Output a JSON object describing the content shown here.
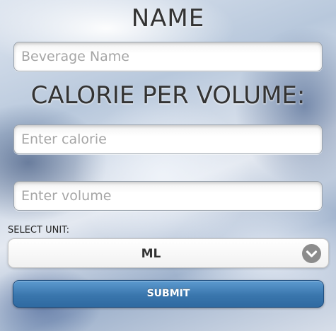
{
  "form": {
    "name_heading": "NAME",
    "beverage_placeholder": "Beverage Name",
    "calorie_heading": "CALORIE PER VOLUME:",
    "calorie_placeholder": "Enter calorie",
    "volume_placeholder": "Enter volume",
    "unit_label": "SELECT UNIT:",
    "unit_selected": "ML",
    "submit_label": "SUBMIT"
  },
  "icons": {
    "dropdown": "chevron-down-icon"
  },
  "colors": {
    "submit_button": "#3a76ad",
    "dropdown_icon": "#8c8c8c"
  }
}
